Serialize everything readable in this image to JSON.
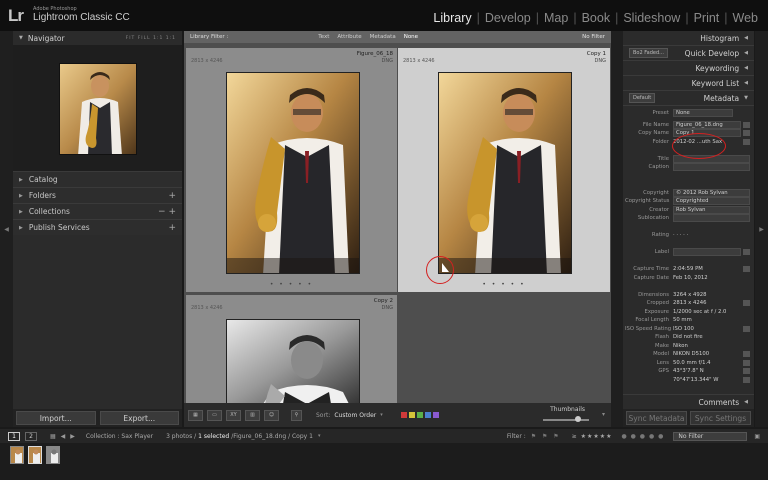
{
  "app": {
    "publisher": "Adobe Photoshop",
    "name": "Lightroom Classic CC",
    "logo": "Lr"
  },
  "modules": [
    "Library",
    "Develop",
    "Map",
    "Book",
    "Slideshow",
    "Print",
    "Web"
  ],
  "active_module": "Library",
  "left_panel": {
    "navigator": {
      "title": "Navigator",
      "options": "FIT  FILL  1:1  1:1"
    },
    "sections": [
      {
        "label": "Catalog",
        "action": ""
      },
      {
        "label": "Folders",
        "action": "+"
      },
      {
        "label": "Collections",
        "action": "−  +"
      },
      {
        "label": "Publish Services",
        "action": "+"
      }
    ],
    "import_label": "Import...",
    "export_label": "Export..."
  },
  "library_filter": {
    "label": "Library Filter :",
    "options": [
      "Text",
      "Attribute",
      "Metadata",
      "None"
    ],
    "active": "None",
    "preset": "No Filter"
  },
  "grid": {
    "cells": [
      {
        "name": "Figure_06_18",
        "dims": "2813 x 4246",
        "ext": "DNG",
        "selected": false
      },
      {
        "name": "Copy 1",
        "dims": "2813 x 4246",
        "ext": "DNG",
        "selected": true
      },
      {
        "name": "Copy 2",
        "dims": "2813 x 4246",
        "ext": "DNG",
        "selected": false
      }
    ]
  },
  "toolbar": {
    "sort_label": "Sort:",
    "sort_value": "Custom Order",
    "thumbnails_label": "Thumbnails",
    "colors": [
      "#d03a3a",
      "#d6c53a",
      "#5bb04a",
      "#4a7fd0",
      "#8a5ad0"
    ]
  },
  "right_panel": {
    "histogram": "Histogram",
    "quick_develop": "Quick Develop",
    "quick_develop_preset": "Bo2 Faded...",
    "keywording": "Keywording",
    "keyword_list": "Keyword List",
    "metadata": "Metadata",
    "metadata_preset_select": "Default",
    "preset_label": "Preset",
    "preset_value": "None",
    "fields": [
      {
        "k": "File Name",
        "v": "Figure_06_18.dng",
        "box": true,
        "icon": true
      },
      {
        "k": "Copy Name",
        "v": "Copy 1",
        "box": true,
        "icon": true
      },
      {
        "k": "Folder",
        "v": "2012-02 ...uth Sax",
        "box": false,
        "icon": true
      },
      {
        "k": "",
        "v": "",
        "box": false,
        "icon": false
      },
      {
        "k": "Title",
        "v": "",
        "box": true,
        "icon": false
      },
      {
        "k": "Caption",
        "v": "",
        "box": true,
        "icon": false
      },
      {
        "k": "",
        "v": "",
        "box": false,
        "icon": false
      },
      {
        "k": "",
        "v": "",
        "box": false,
        "icon": false
      },
      {
        "k": "Copyright",
        "v": "© 2012 Rob Sylvan",
        "box": true,
        "icon": false
      },
      {
        "k": "Copyright Status",
        "v": "Copyrighted",
        "box": true,
        "icon": false
      },
      {
        "k": "Creator",
        "v": "Rob Sylvan",
        "box": true,
        "icon": false
      },
      {
        "k": "Sublocation",
        "v": "",
        "box": true,
        "icon": false
      },
      {
        "k": "",
        "v": "",
        "box": false,
        "icon": false
      },
      {
        "k": "Rating",
        "v": "·  ·  ·  ·  ·",
        "box": false,
        "icon": false
      },
      {
        "k": "",
        "v": "",
        "box": false,
        "icon": false
      },
      {
        "k": "Label",
        "v": "",
        "box": true,
        "icon": true
      },
      {
        "k": "",
        "v": "",
        "box": false,
        "icon": false
      },
      {
        "k": "Capture Time",
        "v": "2:04:59 PM",
        "box": false,
        "icon": true
      },
      {
        "k": "Capture Date",
        "v": "Feb 10, 2012",
        "box": false,
        "icon": false
      },
      {
        "k": "",
        "v": "",
        "box": false,
        "icon": false
      },
      {
        "k": "Dimensions",
        "v": "3264 x 4928",
        "box": false,
        "icon": false
      },
      {
        "k": "Cropped",
        "v": "2813 x 4246",
        "box": false,
        "icon": true
      },
      {
        "k": "Exposure",
        "v": "1/2000 sec at f / 2.0",
        "box": false,
        "icon": false
      },
      {
        "k": "Focal Length",
        "v": "50 mm",
        "box": false,
        "icon": false
      },
      {
        "k": "ISO Speed Rating",
        "v": "ISO 100",
        "box": false,
        "icon": true
      },
      {
        "k": "Flash",
        "v": "Did not fire",
        "box": false,
        "icon": false
      },
      {
        "k": "Make",
        "v": "Nikon",
        "box": false,
        "icon": false
      },
      {
        "k": "Model",
        "v": "NIKON D5100",
        "box": false,
        "icon": true
      },
      {
        "k": "Lens",
        "v": "50.0 mm f/1.4",
        "box": false,
        "icon": true
      },
      {
        "k": "GPS",
        "v": "43°3'7.8\" N",
        "box": false,
        "icon": true
      },
      {
        "k": "",
        "v": "70°47'13.344\" W",
        "box": false,
        "icon": true
      }
    ],
    "comments": "Comments",
    "sync_metadata": "Sync Metadata",
    "sync_settings": "Sync Settings"
  },
  "filmstrip_bar": {
    "page1": "1",
    "page2": "2",
    "collection": "Collection : Sax Player",
    "count": "3 photos /",
    "selected": "1 selected",
    "path": "/Figure_06_18.dng / Copy 1",
    "filter_label": "Filter :",
    "filter_value": "No Filter"
  }
}
